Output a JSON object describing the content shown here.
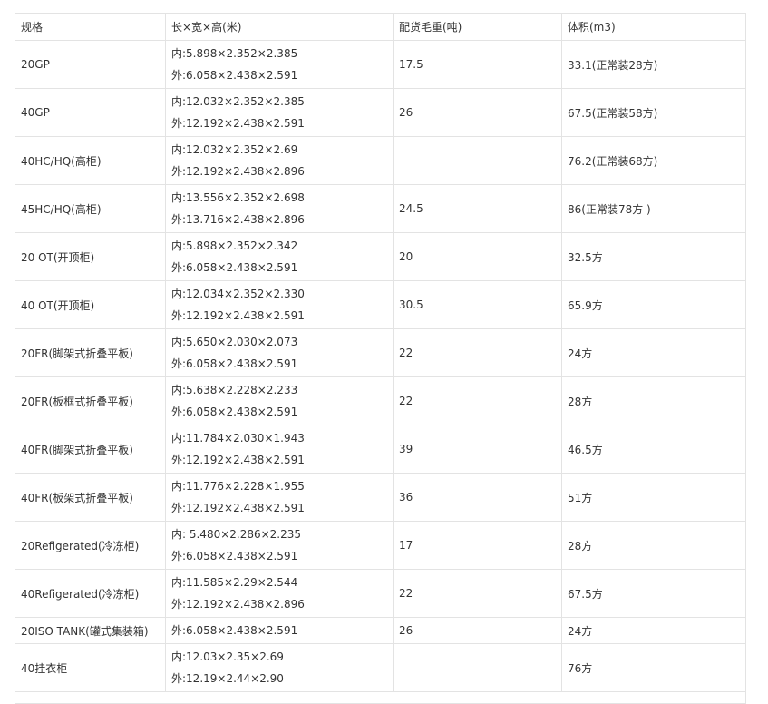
{
  "table": {
    "headers": [
      "规格",
      "长×宽×高(米)",
      "配货毛重(吨)",
      "体积(m3)"
    ],
    "rows": [
      {
        "spec": "20GP",
        "inner": "内:5.898×2.352×2.385",
        "outer": "外:6.058×2.438×2.591",
        "weight": "17.5",
        "volume": "33.1(正常装28方)"
      },
      {
        "spec": "40GP",
        "inner": "内:12.032×2.352×2.385",
        "outer": "外:12.192×2.438×2.591",
        "weight": "26",
        "volume": "67.5(正常装58方)"
      },
      {
        "spec": "40HC/HQ(高柜)",
        "inner": "内:12.032×2.352×2.69",
        "outer": "外:12.192×2.438×2.896",
        "weight": "",
        "volume": "76.2(正常装68方)"
      },
      {
        "spec": "45HC/HQ(高柜)",
        "inner": "内:13.556×2.352×2.698",
        "outer": "外:13.716×2.438×2.896",
        "weight": "24.5",
        "volume": "86(正常装78方 )"
      },
      {
        "spec": "20 OT(开顶柜)",
        "inner": "内:5.898×2.352×2.342",
        "outer": "外:6.058×2.438×2.591",
        "weight": "20",
        "volume": "32.5方"
      },
      {
        "spec": "40 OT(开顶柜)",
        "inner": "内:12.034×2.352×2.330",
        "outer": "外:12.192×2.438×2.591",
        "weight": "30.5",
        "volume": "65.9方"
      },
      {
        "spec": "20FR(脚架式折叠平板)",
        "inner": "内:5.650×2.030×2.073",
        "outer": "外:6.058×2.438×2.591",
        "weight": "22",
        "volume": "24方"
      },
      {
        "spec": "20FR(板框式折叠平板)",
        "inner": "内:5.638×2.228×2.233",
        "outer": "外:6.058×2.438×2.591",
        "weight": "22",
        "volume": "28方"
      },
      {
        "spec": "40FR(脚架式折叠平板)",
        "inner": "内:11.784×2.030×1.943",
        "outer": "外:12.192×2.438×2.591",
        "weight": "39",
        "volume": "46.5方"
      },
      {
        "spec": "40FR(板架式折叠平板)",
        "inner": "内:11.776×2.228×1.955",
        "outer": "外:12.192×2.438×2.591",
        "weight": "36",
        "volume": "51方"
      },
      {
        "spec": "20Refigerated(冷冻柜)",
        "inner": "内: 5.480×2.286×2.235",
        "outer": "外:6.058×2.438×2.591",
        "weight": "17",
        "volume": "28方"
      },
      {
        "spec": "40Refigerated(冷冻柜)",
        "inner": "内:11.585×2.29×2.544",
        "outer": "外:12.192×2.438×2.896",
        "weight": "22",
        "volume": "67.5方"
      },
      {
        "spec": "20ISO TANK(罐式集装箱)",
        "inner": "",
        "outer": "外:6.058×2.438×2.591",
        "weight": "26",
        "volume": "24方"
      },
      {
        "spec": "40挂衣柜",
        "inner": "内:12.03×2.35×2.69",
        "outer": "外:12.19×2.44×2.90",
        "weight": "",
        "volume": "76方"
      }
    ]
  }
}
